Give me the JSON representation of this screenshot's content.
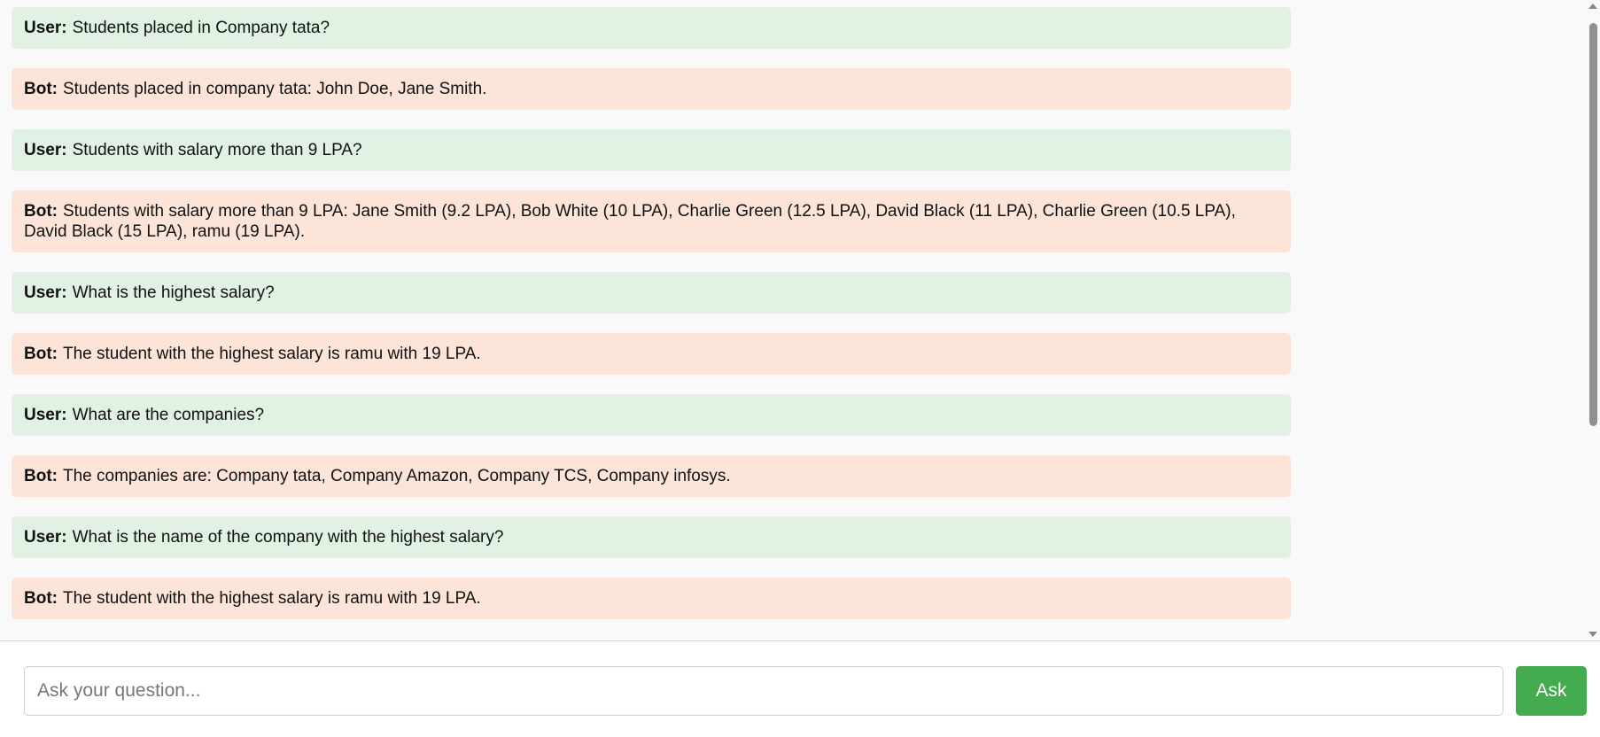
{
  "chat": {
    "messages": [
      {
        "sender": "User:",
        "text": "Students placed in Company tata?"
      },
      {
        "sender": "Bot:",
        "text": "Students placed in company tata: John Doe, Jane Smith."
      },
      {
        "sender": "User:",
        "text": "Students with salary more than 9 LPA?"
      },
      {
        "sender": "Bot:",
        "text": "Students with salary more than 9 LPA: Jane Smith (9.2 LPA), Bob White (10 LPA), Charlie Green (12.5 LPA), David Black (11 LPA), Charlie Green (10.5 LPA), David Black (15 LPA), ramu (19 LPA)."
      },
      {
        "sender": "User:",
        "text": "What is the highest salary?"
      },
      {
        "sender": "Bot:",
        "text": "The student with the highest salary is ramu with 19 LPA."
      },
      {
        "sender": "User:",
        "text": "What are the companies?"
      },
      {
        "sender": "Bot:",
        "text": "The companies are: Company tata, Company Amazon, Company TCS, Company infosys."
      },
      {
        "sender": "User:",
        "text": "What is the name of the company with the highest salary?"
      },
      {
        "sender": "Bot:",
        "text": "The student with the highest salary is ramu with 19 LPA."
      }
    ]
  },
  "input": {
    "placeholder": "Ask your question...",
    "value": ""
  },
  "ask_button": {
    "label": "Ask"
  },
  "colors": {
    "user_bubble": "#e1f1e4",
    "bot_bubble": "#fce4d8",
    "ask_button": "#45ab4f"
  }
}
